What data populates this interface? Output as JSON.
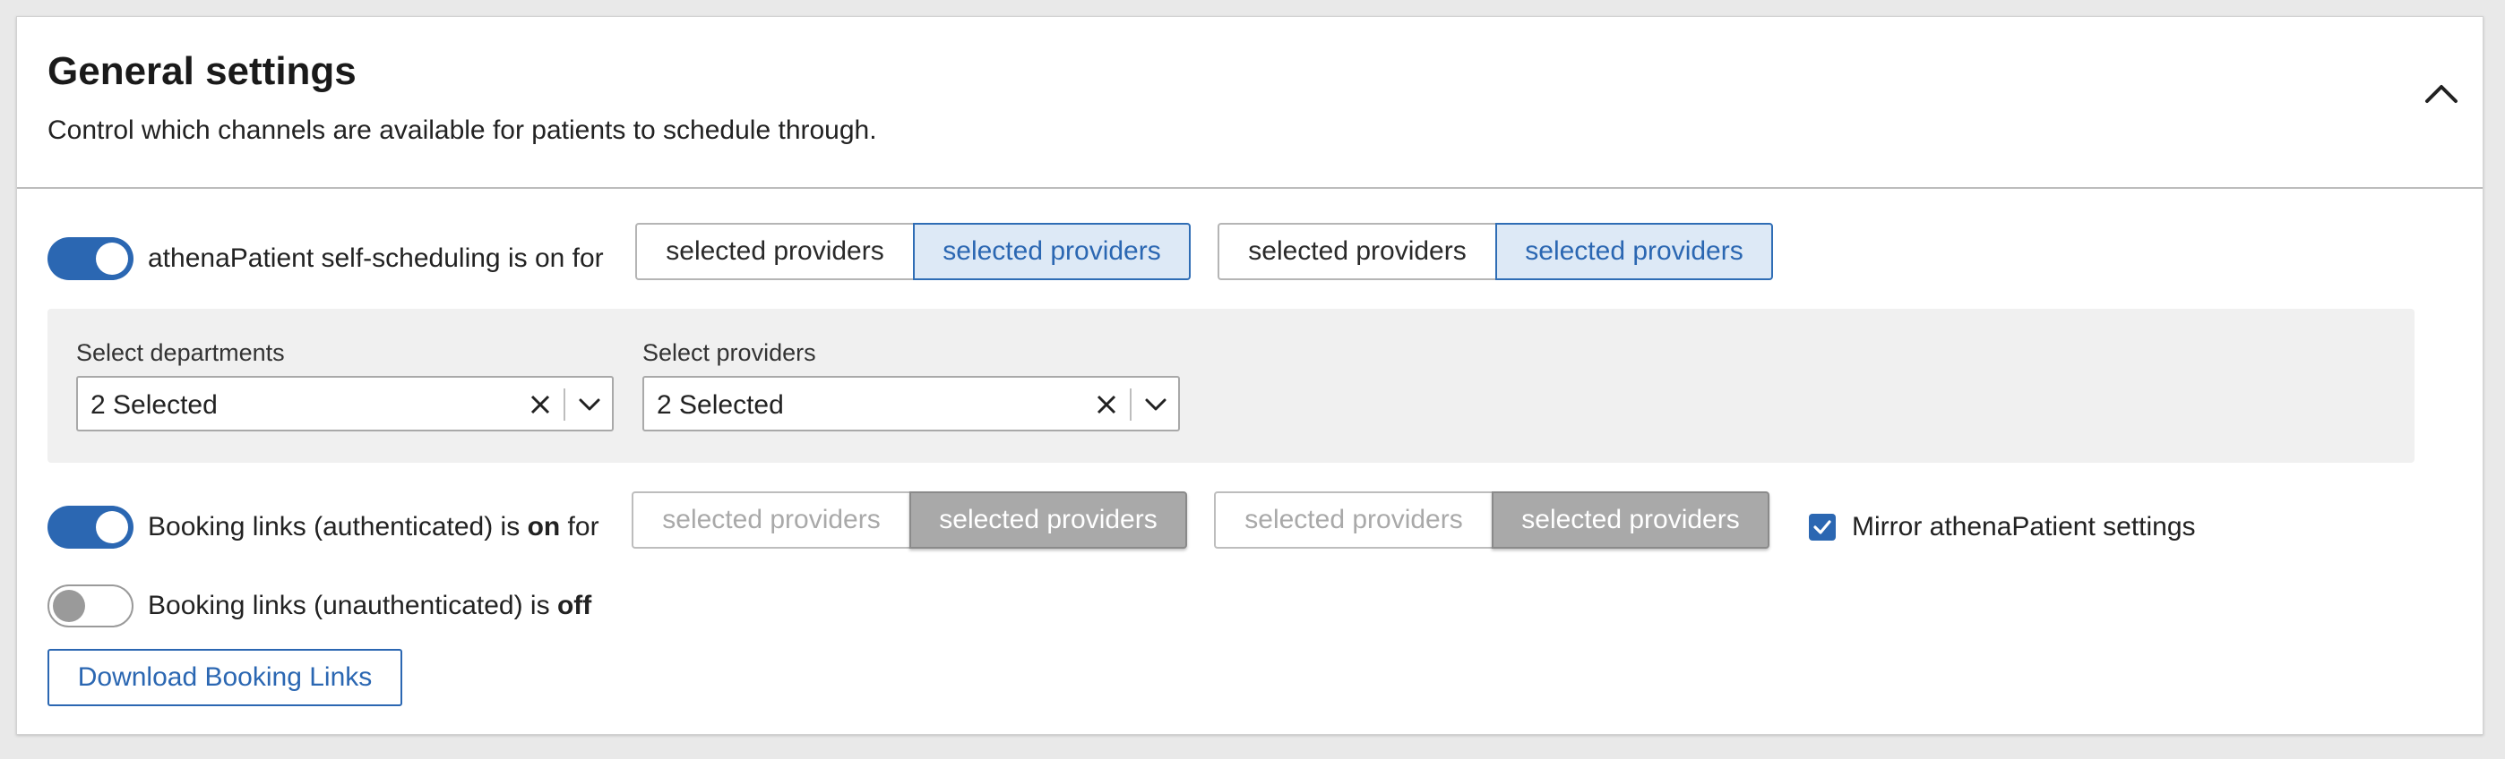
{
  "header": {
    "title": "General settings",
    "subtitle": "Control which channels are available for patients to schedule through."
  },
  "athena": {
    "label": "athenaPatient self-scheduling is on for",
    "toggle_state": "on",
    "segment1": [
      "selected providers",
      "selected providers"
    ],
    "segment2": [
      "selected providers",
      "selected providers"
    ]
  },
  "filters": {
    "departments": {
      "label": "Select departments",
      "value": "2 Selected"
    },
    "providers": {
      "label": "Select providers",
      "value": "2 Selected"
    }
  },
  "booking_auth": {
    "label_prefix": "Booking links (authenticated) is ",
    "state_word": "on",
    "label_suffix": " for",
    "toggle_state": "on",
    "segment1": [
      "selected providers",
      "selected providers"
    ],
    "segment2": [
      "selected providers",
      "selected providers"
    ],
    "mirror_label": "Mirror athenaPatient settings",
    "mirror_checked": true
  },
  "booking_unauth": {
    "label_prefix": "Booking links (unauthenticated) is ",
    "state_word": "off",
    "toggle_state": "off"
  },
  "download_button": "Download Booking Links",
  "colors": {
    "accent": "#2b67b2",
    "selected_bg": "#dde9f6",
    "disabled_selected_bg": "#a9a9a9",
    "panel_bg": "#f0f0f0"
  }
}
